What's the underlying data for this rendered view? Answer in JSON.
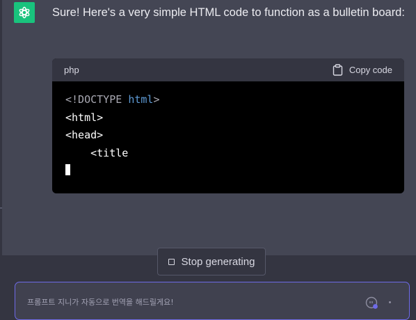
{
  "message": {
    "avatar_icon": "chatgpt-logo-icon",
    "text": "Sure! Here's a very simple HTML code to function as a bulletin board:"
  },
  "code_block": {
    "language": "php",
    "copy_label": "Copy code",
    "copy_icon": "clipboard-icon",
    "lines": [
      [
        {
          "text": "<!DOCTYPE ",
          "color": "#a9a9b3"
        },
        {
          "text": "html",
          "color": "#5e9bd6"
        },
        {
          "text": ">",
          "color": "#a9a9b3"
        }
      ],
      [
        {
          "text": "<html>",
          "color": "#ffffff"
        }
      ],
      [
        {
          "text": "<head>",
          "color": "#ffffff"
        }
      ],
      [
        {
          "text": "    <title",
          "color": "#ffffff"
        }
      ]
    ]
  },
  "stop_button": {
    "label": "Stop generating",
    "icon": "stop-square-icon"
  },
  "prompt": {
    "placeholder": "프롬프트 지니가 자동으로 번역을 해드릴게요!",
    "icon": "prompt-genie-icon"
  },
  "colors": {
    "accent": "#19c37d",
    "input_border": "#6e6ae8"
  }
}
